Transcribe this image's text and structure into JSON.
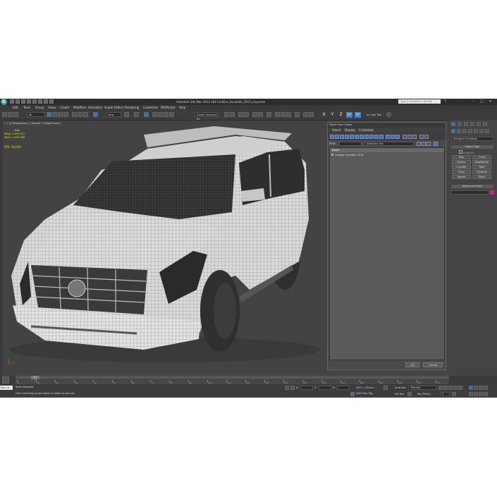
{
  "window": {
    "title": "Autodesk 3ds Max  2012 x64     Cadillac_Escalade_2015_vray.max",
    "logo_letter": "G",
    "search_placeholder": "Type a keyword or phrase"
  },
  "menu": [
    "Edit",
    "Tools",
    "Group",
    "Views",
    "Create",
    "Modifiers",
    "Animation",
    "Graph Editors",
    "Rendering",
    "Customize",
    "MAXScript",
    "Help"
  ],
  "toolbar": {
    "filter_value": "All",
    "reference_coord": "View",
    "named_selection": "Create Selection Se",
    "axis_buttons": [
      "X",
      "Y",
      "Z",
      "XY",
      "XY"
    ],
    "viewport_shading": "ay Cam Tool"
  },
  "viewport": {
    "label": "[ + ] [ Perspective ] [ Shaded + Edged Faces ]",
    "stats_total_label": "Total",
    "polys_label": "Polys:",
    "polys_value": "2 070 412",
    "verts_label": "Verts:",
    "verts_value": "1 030 596",
    "fps_label": "FPS:",
    "fps_value": "20,052"
  },
  "select_dialog": {
    "title": "Select From Scene",
    "menu": [
      "Select",
      "Display",
      "Customize"
    ],
    "find_label": "Find:",
    "selection_set": "Selection Set:",
    "column_header": "Name",
    "items": [
      "Cadillac Escalade 2015"
    ],
    "ok_label": "OK",
    "cancel_label": "Cancel"
  },
  "command_panel": {
    "category": "Standard Primitives",
    "object_type_title": "Object Type",
    "autogrid_label": "AutoGrid",
    "object_buttons": [
      "Box",
      "Cone",
      "Sphere",
      "GeoSphere",
      "Cylinder",
      "Tube",
      "Torus",
      "Pyramid",
      "Teapot",
      "Plane"
    ],
    "name_color_title": "Name and Color"
  },
  "timeline": {
    "position": "0 / 225",
    "ticks": [
      "0",
      "10",
      "20",
      "30",
      "40",
      "50",
      "60",
      "70",
      "80",
      "90",
      "100",
      "110",
      "120",
      "130",
      "140",
      "150",
      "160",
      "170",
      "180",
      "190",
      "200",
      "210",
      "220"
    ]
  },
  "status": {
    "maxscript": "Max to",
    "selection_status": "None Selected",
    "prompt": "Click and drag up-and-down to zoom in and out",
    "x_label": "X:",
    "y_label": "Y:",
    "z_label": "Z:",
    "grid": "Grid = 10,0cm",
    "auto_key": "Auto Key",
    "set_key": "Set Key",
    "key_filter_value": "Selected",
    "key_filters": "Key Filters...",
    "add_time_tag": "Add Time Tag",
    "frame_value": "0"
  },
  "colors": {
    "ui_bg": "#444444",
    "accent_blue": "#2a78c8",
    "stats_yellow": "#e6e600",
    "name_color": "#c8288c"
  }
}
